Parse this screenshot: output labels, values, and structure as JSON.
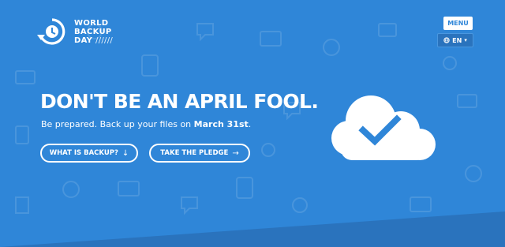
{
  "logo": {
    "line1": "WORLD",
    "line2": "BACKUP",
    "line3": "DAY",
    "slashes": "//////",
    "icon": "backup-clock-icon"
  },
  "nav": {
    "menu_label": "MENU",
    "language": "EN",
    "language_icon": "globe-icon",
    "caret_icon": "chevron-down-icon"
  },
  "hero": {
    "headline": "DON'T BE AN APRIL FOOL.",
    "subline_prefix": "Be prepared. Back up your files on ",
    "subline_date": "March 31st",
    "subline_suffix": ".",
    "cloud_icon": "cloud-check-icon"
  },
  "buttons": {
    "what_is_backup": "WHAT IS BACKUP?",
    "what_is_backup_arrow": "↓",
    "take_pledge": "TAKE THE PLEDGE",
    "take_pledge_arrow": "→"
  },
  "colors": {
    "background": "#2f86d8",
    "background_dark": "#2a73bd",
    "text": "#ffffff"
  }
}
